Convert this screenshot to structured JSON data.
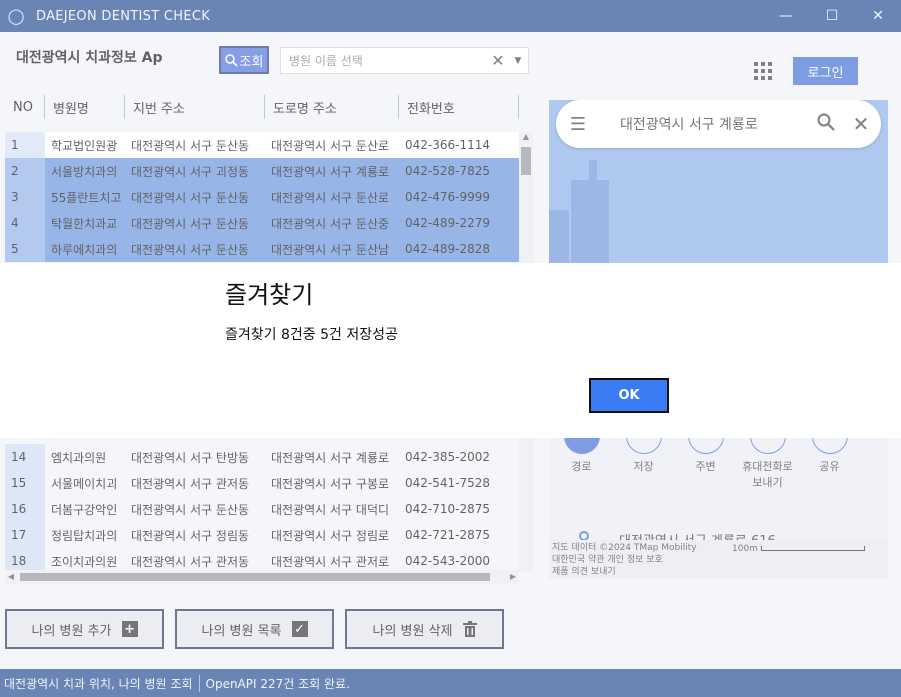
{
  "window": {
    "title": "DAEJEON DENTIST CHECK",
    "app_icon": "tooth-icon",
    "controls": [
      "minimize-icon",
      "maximize-icon",
      "close-icon"
    ]
  },
  "header": {
    "title": "대전광역시 치과정보 Ap",
    "search_button": "조회",
    "search_placeholder": "병원 이름 선택",
    "login_button": "로그인"
  },
  "table": {
    "columns": [
      "NO",
      "병원명",
      "지번 주소",
      "도로명 주소",
      "전화번호"
    ],
    "rows": [
      {
        "no": "1",
        "name": "학교법인원광",
        "jibun": "대전광역시 서구 둔산동",
        "road": "대전광역시 서구 둔산로",
        "tel": "042-366-1114",
        "selected": false
      },
      {
        "no": "2",
        "name": "서울방치과의",
        "jibun": "대전광역시 서구 괴정동",
        "road": "대전광역시 서구 계룡로",
        "tel": "042-528-7825",
        "selected": true
      },
      {
        "no": "3",
        "name": "55플란트치고",
        "jibun": "대전광역시 서구 둔산동",
        "road": "대전광역시 서구 둔산로",
        "tel": "042-476-9999",
        "selected": true
      },
      {
        "no": "4",
        "name": "탁월한치과교",
        "jibun": "대전광역시 서구 둔산동",
        "road": "대전광역시 서구 둔산중",
        "tel": "042-489-2279",
        "selected": true
      },
      {
        "no": "5",
        "name": "하루에치과의",
        "jibun": "대전광역시 서구 둔산동",
        "road": "대전광역시 서구 둔산남",
        "tel": "042-489-2828",
        "selected": true
      },
      {
        "no": "14",
        "name": "엠치과의원",
        "jibun": "대전광역시 서구 탄방동",
        "road": "대전광역시 서구 계룡로",
        "tel": "042-385-2002",
        "selected": false
      },
      {
        "no": "15",
        "name": "서울메이치괴",
        "jibun": "대전광역시 서구 관저동",
        "road": "대전광역시 서구 구봉로",
        "tel": "042-541-7528",
        "selected": false
      },
      {
        "no": "16",
        "name": "더봄구강악인",
        "jibun": "대전광역시 서구 둔산동",
        "road": "대전광역시 서구 대덕디",
        "tel": "042-710-2875",
        "selected": false
      },
      {
        "no": "17",
        "name": "정림탑치과의",
        "jibun": "대전광역시 서구 정림동",
        "road": "대전광역시 서구 정림로",
        "tel": "042-721-2875",
        "selected": false
      },
      {
        "no": "18",
        "name": "조이치과의원",
        "jibun": "대전광역시 서구 관저동",
        "road": "대전광역시 서구 관저로",
        "tel": "042-543-2000",
        "selected": false
      }
    ]
  },
  "buttons": {
    "add": "나의 병원 추가",
    "list": "나의 병원 목록",
    "delete": "나의 병원 삭제"
  },
  "map": {
    "search_text": "대전광역시 서구 계룡로",
    "actions": [
      "경로",
      "저장",
      "주변",
      "휴대전화로 보내기",
      "공유"
    ],
    "address": "대전광역시 서구 계룡로 616",
    "credits_line1": "지도 데이터 ©2024 TMap Mobility",
    "credits_line2": "대한민국  약관  개인 정보 보호",
    "credits_line3": "제품 의견 보내기",
    "scale": "100m"
  },
  "status": {
    "left": "대전광역시 치과 위치, 나의 병원 조회",
    "right": "OpenAPI 227건 조회 완료."
  },
  "dialog": {
    "title": "즐겨찾기",
    "message": "즐겨찾기 8건중 5건 저장성공",
    "ok": "OK"
  },
  "colors": {
    "titlebar": "#0f3a85",
    "accent": "#2f5fd0",
    "selected_row": "#5a88d8",
    "ok_button": "#3b7cf5"
  }
}
